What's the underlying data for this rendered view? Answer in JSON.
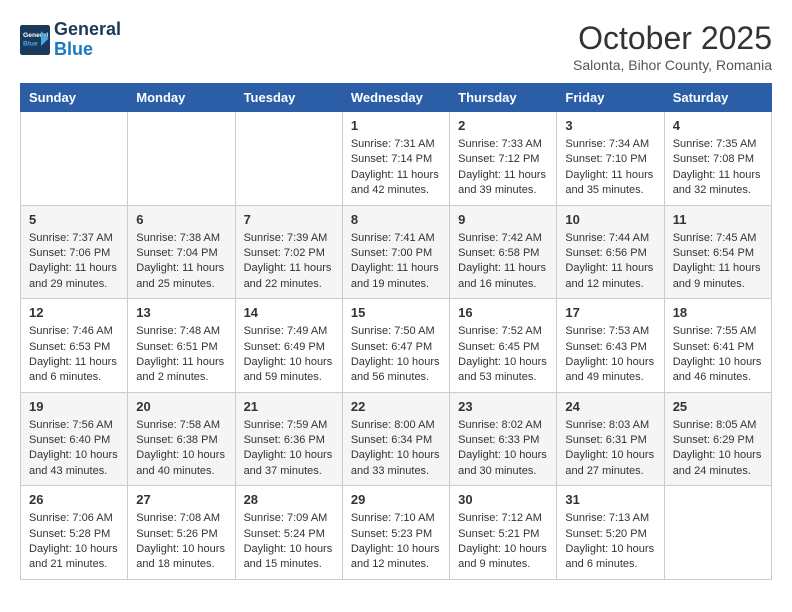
{
  "header": {
    "logo_line1": "General",
    "logo_line2": "Blue",
    "month": "October 2025",
    "subtitle": "Salonta, Bihor County, Romania"
  },
  "weekdays": [
    "Sunday",
    "Monday",
    "Tuesday",
    "Wednesday",
    "Thursday",
    "Friday",
    "Saturday"
  ],
  "weeks": [
    [
      {
        "day": "",
        "info": ""
      },
      {
        "day": "",
        "info": ""
      },
      {
        "day": "",
        "info": ""
      },
      {
        "day": "1",
        "info": "Sunrise: 7:31 AM\nSunset: 7:14 PM\nDaylight: 11 hours\nand 42 minutes."
      },
      {
        "day": "2",
        "info": "Sunrise: 7:33 AM\nSunset: 7:12 PM\nDaylight: 11 hours\nand 39 minutes."
      },
      {
        "day": "3",
        "info": "Sunrise: 7:34 AM\nSunset: 7:10 PM\nDaylight: 11 hours\nand 35 minutes."
      },
      {
        "day": "4",
        "info": "Sunrise: 7:35 AM\nSunset: 7:08 PM\nDaylight: 11 hours\nand 32 minutes."
      }
    ],
    [
      {
        "day": "5",
        "info": "Sunrise: 7:37 AM\nSunset: 7:06 PM\nDaylight: 11 hours\nand 29 minutes."
      },
      {
        "day": "6",
        "info": "Sunrise: 7:38 AM\nSunset: 7:04 PM\nDaylight: 11 hours\nand 25 minutes."
      },
      {
        "day": "7",
        "info": "Sunrise: 7:39 AM\nSunset: 7:02 PM\nDaylight: 11 hours\nand 22 minutes."
      },
      {
        "day": "8",
        "info": "Sunrise: 7:41 AM\nSunset: 7:00 PM\nDaylight: 11 hours\nand 19 minutes."
      },
      {
        "day": "9",
        "info": "Sunrise: 7:42 AM\nSunset: 6:58 PM\nDaylight: 11 hours\nand 16 minutes."
      },
      {
        "day": "10",
        "info": "Sunrise: 7:44 AM\nSunset: 6:56 PM\nDaylight: 11 hours\nand 12 minutes."
      },
      {
        "day": "11",
        "info": "Sunrise: 7:45 AM\nSunset: 6:54 PM\nDaylight: 11 hours\nand 9 minutes."
      }
    ],
    [
      {
        "day": "12",
        "info": "Sunrise: 7:46 AM\nSunset: 6:53 PM\nDaylight: 11 hours\nand 6 minutes."
      },
      {
        "day": "13",
        "info": "Sunrise: 7:48 AM\nSunset: 6:51 PM\nDaylight: 11 hours\nand 2 minutes."
      },
      {
        "day": "14",
        "info": "Sunrise: 7:49 AM\nSunset: 6:49 PM\nDaylight: 10 hours\nand 59 minutes."
      },
      {
        "day": "15",
        "info": "Sunrise: 7:50 AM\nSunset: 6:47 PM\nDaylight: 10 hours\nand 56 minutes."
      },
      {
        "day": "16",
        "info": "Sunrise: 7:52 AM\nSunset: 6:45 PM\nDaylight: 10 hours\nand 53 minutes."
      },
      {
        "day": "17",
        "info": "Sunrise: 7:53 AM\nSunset: 6:43 PM\nDaylight: 10 hours\nand 49 minutes."
      },
      {
        "day": "18",
        "info": "Sunrise: 7:55 AM\nSunset: 6:41 PM\nDaylight: 10 hours\nand 46 minutes."
      }
    ],
    [
      {
        "day": "19",
        "info": "Sunrise: 7:56 AM\nSunset: 6:40 PM\nDaylight: 10 hours\nand 43 minutes."
      },
      {
        "day": "20",
        "info": "Sunrise: 7:58 AM\nSunset: 6:38 PM\nDaylight: 10 hours\nand 40 minutes."
      },
      {
        "day": "21",
        "info": "Sunrise: 7:59 AM\nSunset: 6:36 PM\nDaylight: 10 hours\nand 37 minutes."
      },
      {
        "day": "22",
        "info": "Sunrise: 8:00 AM\nSunset: 6:34 PM\nDaylight: 10 hours\nand 33 minutes."
      },
      {
        "day": "23",
        "info": "Sunrise: 8:02 AM\nSunset: 6:33 PM\nDaylight: 10 hours\nand 30 minutes."
      },
      {
        "day": "24",
        "info": "Sunrise: 8:03 AM\nSunset: 6:31 PM\nDaylight: 10 hours\nand 27 minutes."
      },
      {
        "day": "25",
        "info": "Sunrise: 8:05 AM\nSunset: 6:29 PM\nDaylight: 10 hours\nand 24 minutes."
      }
    ],
    [
      {
        "day": "26",
        "info": "Sunrise: 7:06 AM\nSunset: 5:28 PM\nDaylight: 10 hours\nand 21 minutes."
      },
      {
        "day": "27",
        "info": "Sunrise: 7:08 AM\nSunset: 5:26 PM\nDaylight: 10 hours\nand 18 minutes."
      },
      {
        "day": "28",
        "info": "Sunrise: 7:09 AM\nSunset: 5:24 PM\nDaylight: 10 hours\nand 15 minutes."
      },
      {
        "day": "29",
        "info": "Sunrise: 7:10 AM\nSunset: 5:23 PM\nDaylight: 10 hours\nand 12 minutes."
      },
      {
        "day": "30",
        "info": "Sunrise: 7:12 AM\nSunset: 5:21 PM\nDaylight: 10 hours\nand 9 minutes."
      },
      {
        "day": "31",
        "info": "Sunrise: 7:13 AM\nSunset: 5:20 PM\nDaylight: 10 hours\nand 6 minutes."
      },
      {
        "day": "",
        "info": ""
      }
    ]
  ]
}
